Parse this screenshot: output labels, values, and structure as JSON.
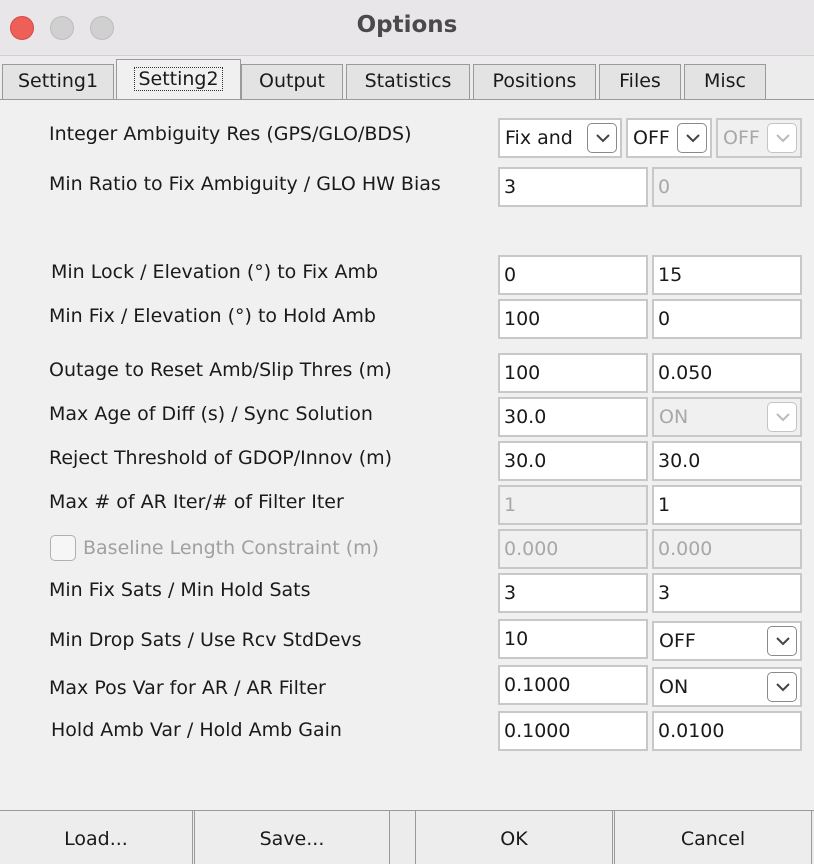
{
  "window": {
    "title": "Options"
  },
  "tabs": [
    {
      "label": "Setting1"
    },
    {
      "label": "Setting2"
    },
    {
      "label": "Output"
    },
    {
      "label": "Statistics"
    },
    {
      "label": "Positions"
    },
    {
      "label": "Files"
    },
    {
      "label": "Misc"
    }
  ],
  "rows": {
    "ar": {
      "label": "Integer Ambiguity Res (GPS/GLO/BDS)",
      "gps": "Fix and",
      "glo": "OFF",
      "bds": "OFF"
    },
    "ratio": {
      "label": "Min Ratio to Fix Ambiguity / GLO HW Bias",
      "v1": "3",
      "v2": "0"
    },
    "lock": {
      "label": "Min Lock / Elevation (°) to Fix Amb",
      "v1": "0",
      "v2": "15"
    },
    "fix": {
      "label": "Min Fix / Elevation (°) to Hold Amb",
      "v1": "100",
      "v2": "0"
    },
    "outage": {
      "label": "Outage to Reset Amb/Slip Thres (m)",
      "v1": "100",
      "v2": "0.050"
    },
    "age": {
      "label": "Max Age of Diff (s) / Sync Solution",
      "v1": "30.0",
      "v2": "ON"
    },
    "reject": {
      "label": "Reject Threshold of GDOP/Innov (m)",
      "v1": "30.0",
      "v2": "30.0"
    },
    "iter": {
      "label": "Max # of AR Iter/# of Filter Iter",
      "v1": "1",
      "v2": "1"
    },
    "baseline": {
      "label": "Baseline Length Constraint (m)",
      "v1": "0.000",
      "v2": "0.000"
    },
    "sats": {
      "label": "Min Fix Sats / Min Hold Sats",
      "v1": "3",
      "v2": "3"
    },
    "drop": {
      "label": "Min Drop Sats / Use Rcv StdDevs",
      "v1": "10",
      "v2": "OFF"
    },
    "posvar": {
      "label": "Max Pos Var for AR / AR Filter",
      "v1": "0.1000",
      "v2": "ON"
    },
    "hold": {
      "label": "Hold Amb Var / Hold Amb Gain",
      "v1": "0.1000",
      "v2": "0.0100"
    }
  },
  "buttons": {
    "load": "Load...",
    "save": "Save...",
    "ok": "OK",
    "cancel": "Cancel"
  }
}
